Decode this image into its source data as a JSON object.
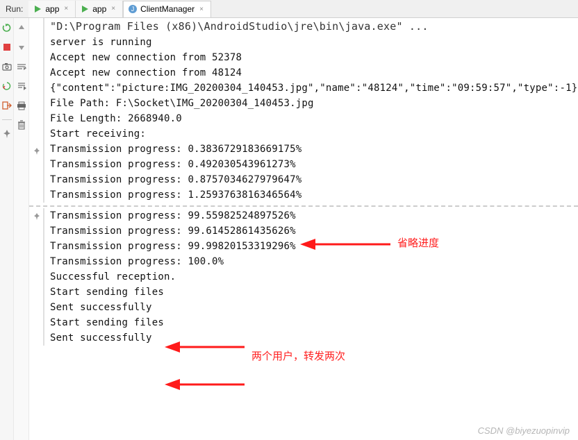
{
  "topbar": {
    "run_label": "Run:",
    "tabs": [
      {
        "label": "app",
        "active": false,
        "icon": "play-triangle-icon"
      },
      {
        "label": "app",
        "active": false,
        "icon": "play-triangle-icon"
      },
      {
        "label": "ClientManager",
        "active": true,
        "icon": "java-class-icon"
      }
    ]
  },
  "gutter1": {
    "icons": [
      "rerun-icon",
      "stop-icon",
      "camera-icon",
      "recycle-run-icon",
      "exit-icon",
      "divider",
      "pin-icon"
    ]
  },
  "gutter2": {
    "icons": [
      "arrow-up-icon",
      "arrow-down-icon",
      "wrap-icon",
      "scroll-to-end-icon",
      "print-icon",
      "trash-icon"
    ]
  },
  "block1": {
    "header": "\"D:\\Program Files (x86)\\AndroidStudio\\jre\\bin\\java.exe\" ...",
    "lines": [
      "server is running",
      "Accept new connection from 52378",
      "Accept new connection from 48124",
      "{\"content\":\"picture:IMG_20200304_140453.jpg\",\"name\":\"48124\",\"time\":\"09:59:57\",\"type\":-1}",
      "File Path: F:\\Socket\\IMG_20200304_140453.jpg",
      "File Length: 2668940.0",
      "Start receiving:",
      "Transmission progress: 0.3836729183669175%",
      "Transmission progress: 0.49203054396127З%",
      "Transmission progress: 0.8757034627979647%",
      "Transmission progress: 1.2593763816346564%"
    ]
  },
  "block2": {
    "lines": [
      "Transmission progress: 99.55982524897526%",
      "Transmission progress: 99.61452861435626%",
      "Transmission progress: 99.99820153319296%",
      "Transmission progress: 100.0%",
      "Successful reception.",
      "Start sending files",
      "Sent successfully",
      "Start sending files",
      "Sent successfully"
    ]
  },
  "annotations": {
    "skip": "省略进度",
    "forward": "两个用户，转发两次"
  },
  "watermark": "CSDN @biyezuopinvip"
}
